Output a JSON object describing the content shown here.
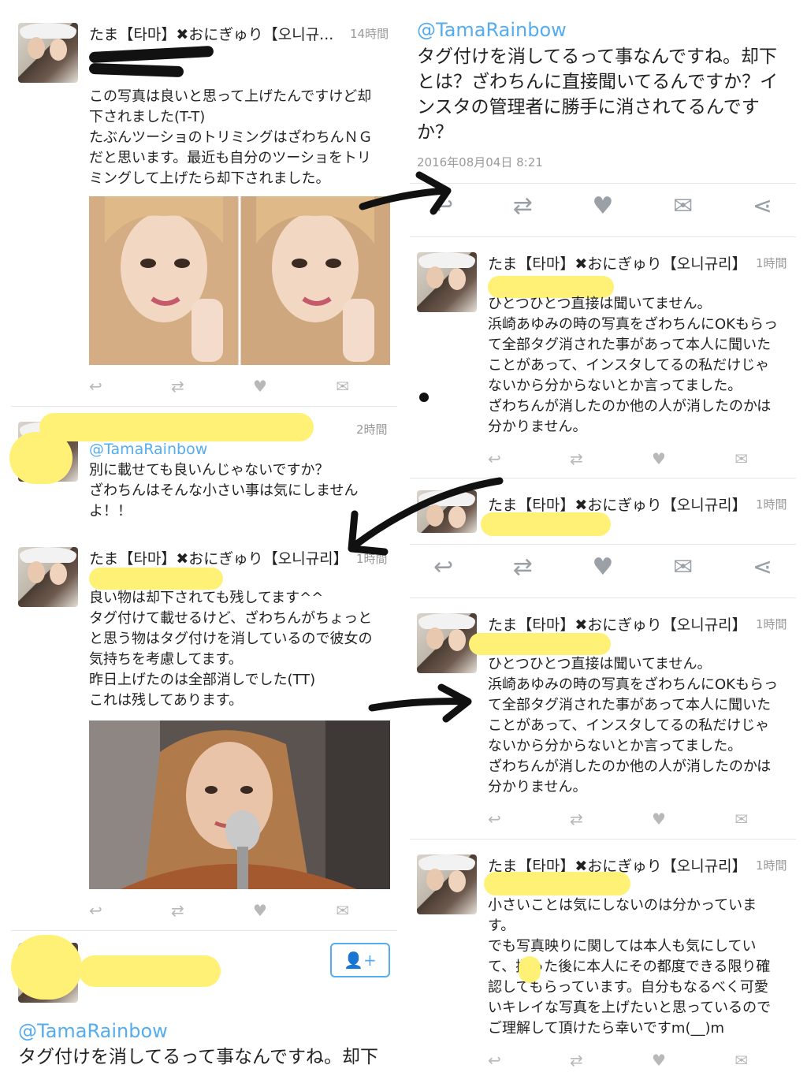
{
  "tweets_left": {
    "t1": {
      "name": "たま【타마】✖おにぎゅり【오니규...",
      "time": "14時間",
      "text": "この写真は良いと思って上げたんですけど却\n下されました(T-T)\nたぶんツーショのトリミングはざわちんＮＧ\nだと思います。最近も自分のツーショをトリ\nミングして上げたら却下されました。"
    },
    "t2": {
      "time": "2時間",
      "handle": "@TamaRainbow",
      "text": "別に載せても良いんじゃないですか？\nざわちんはそんな小さい事は気にしません\nよ！！"
    },
    "t3": {
      "name": "たま【타마】✖おにぎゅり【오니규리】",
      "time": "1時間",
      "text": "良い物は却下されても残してます^^\nタグ付けて載せるけど、ざわちんがちょっと\nと思う物はタグ付けを消しているので彼女の\n気持ちを考慮してます。\n昨日上げたのは全部消しでした(TT)\nこれは残してあります。"
    },
    "t4": {
      "handle": "@TamaRainbow",
      "text": "タグ付けを消してるって事なんですね。却下"
    }
  },
  "tweets_right": {
    "main": {
      "handle": "@TamaRainbow",
      "text": "タグ付けを消してるって事なんですね。却下\nとは？ざわちんに直接聞いてるんですか？イ\nンスタの管理者に勝手に消されてるんです\nか？",
      "timestamp": "2016年08月04日 8:21"
    },
    "r1": {
      "name": "たま【타마】✖おにぎゅり【오니규리】",
      "time": "1時間",
      "text": "ひとつひとつ直接は聞いてません。\n浜崎あゆみの時の写真をざわちんにOKもらっ\nて全部タグ消された事があって本人に聞いた\nことがあって、インスタしてるの私だけじゃ\nないから分からないとか言ってました。\nざわちんが消したのか他の人が消したのかは\n分かりません。"
    },
    "r2": {
      "name": "たま【타마】✖おにぎゅり【오니규리】",
      "time": "1時間"
    },
    "r3": {
      "name": "たま【타마】✖おにぎゅり【오니규리】",
      "time": "1時間",
      "text": "ひとつひとつ直接は聞いてません。\n浜崎あゆみの時の写真をざわちんにOKもらっ\nて全部タグ消された事があって本人に聞いた\nことがあって、インスタしてるの私だけじゃ\nないから分からないとか言ってました。\nざわちんが消したのか他の人が消したのかは\n分かりません。"
    },
    "r4": {
      "name": "たま【타마】✖おにぎゅり【오니규리】",
      "time": "1時間",
      "text": "小さいことは気にしないのは分かっていま\nす。\nでも写真映りに関しては本人も気にしてい\nて、撮った後に本人にその都度できる限り確\n認してもらっています。自分もなるべく可愛\nいキレイな写真を上げたいと思っているので\nご理解して頂けたら幸いですm(__)m"
    }
  },
  "icons": {
    "reply": "reply-icon",
    "retweet": "retweet-icon",
    "like": "heart-icon",
    "dm": "envelope-icon",
    "share": "share-icon",
    "follow": "follow-user-icon"
  },
  "colors": {
    "link": "#55acee",
    "highlight": "#fff176"
  }
}
